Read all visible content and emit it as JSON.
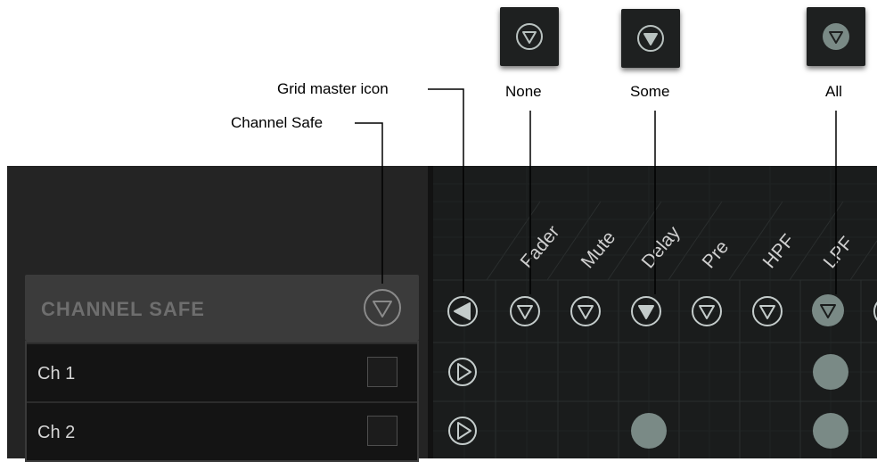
{
  "callouts": {
    "grid_master": "Grid master icon",
    "channel_safe": "Channel Safe",
    "none": "None",
    "some": "Some",
    "all": "All"
  },
  "panel": {
    "channel_safe_title": "CHANNEL SAFE",
    "channels": [
      {
        "name": "Ch 1"
      },
      {
        "name": "Ch 2"
      }
    ],
    "columns": [
      "Fader",
      "Mute",
      "Delay",
      "Pre",
      "HPF",
      "LPF"
    ]
  },
  "colors": {
    "panel_bg": "#1b1b1b",
    "header_bg": "#3b3b3b",
    "icon_outline": "#b9c2c0",
    "state_fill": "#7a8a86",
    "text_light": "#d6d6d6"
  },
  "icons": {
    "state_none": "triangle-down-outline-icon",
    "state_some": "triangle-down-filled-icon",
    "state_all": "triangle-down-in-filled-circle-icon",
    "grid_master": "triangle-left-filled-icon",
    "row_master": "triangle-right-icon"
  }
}
